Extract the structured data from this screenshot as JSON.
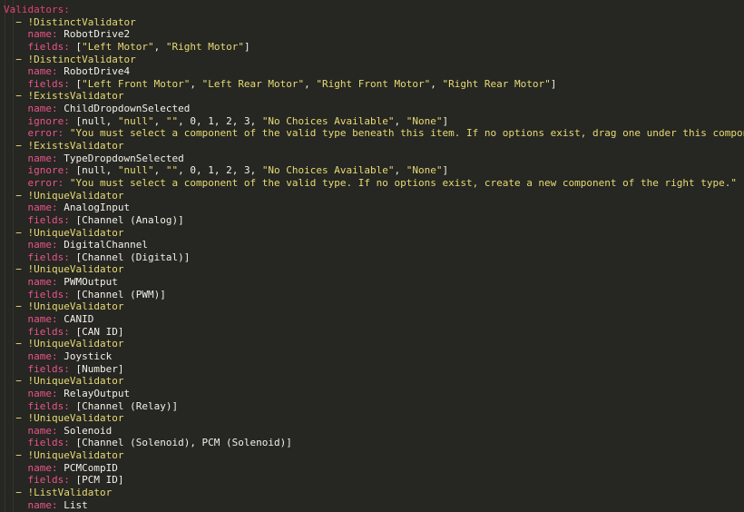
{
  "editor": {
    "background": "#262622",
    "language": "yaml",
    "colors": {
      "root_key": "#E0456F",
      "key": "#E8558A",
      "tag": "#E6DB74",
      "string": "#E6DB74",
      "plain": "#F2F0E8",
      "indent_guide": "#35342e"
    }
  },
  "document": {
    "root_key": "Validators:",
    "lines": [
      {
        "indent": 0,
        "type": "root",
        "text": "Validators:"
      },
      {
        "indent": 1,
        "type": "item",
        "tag": "!DistinctValidator"
      },
      {
        "indent": 2,
        "type": "pair",
        "key": "name:",
        "value": "RobotDrive2",
        "value_kind": "plain"
      },
      {
        "indent": 2,
        "type": "pair",
        "key": "fields:",
        "value": "[\"Left Motor\", \"Right Motor\"]",
        "value_kind": "seq"
      },
      {
        "indent": 1,
        "type": "item",
        "tag": "!DistinctValidator"
      },
      {
        "indent": 2,
        "type": "pair",
        "key": "name:",
        "value": "RobotDrive4",
        "value_kind": "plain"
      },
      {
        "indent": 2,
        "type": "pair",
        "key": "fields:",
        "value": "[\"Left Front Motor\", \"Left Rear Motor\", \"Right Front Motor\", \"Right Rear Motor\"]",
        "value_kind": "seq"
      },
      {
        "indent": 1,
        "type": "item",
        "tag": "!ExistsValidator"
      },
      {
        "indent": 2,
        "type": "pair",
        "key": "name:",
        "value": "ChildDropdownSelected",
        "value_kind": "plain"
      },
      {
        "indent": 2,
        "type": "pair",
        "key": "ignore:",
        "value": "[null, \"null\", \"\", 0, 1, 2, 3, \"No Choices Available\", \"None\"]",
        "value_kind": "seq"
      },
      {
        "indent": 2,
        "type": "pair",
        "key": "error:",
        "value": "\"You must select a component of the valid type beneath this item. If no options exist, drag one under this component.\"",
        "value_kind": "string"
      },
      {
        "indent": 1,
        "type": "item",
        "tag": "!ExistsValidator"
      },
      {
        "indent": 2,
        "type": "pair",
        "key": "name:",
        "value": "TypeDropdownSelected",
        "value_kind": "plain"
      },
      {
        "indent": 2,
        "type": "pair",
        "key": "ignore:",
        "value": "[null, \"null\", \"\", 0, 1, 2, 3, \"No Choices Available\", \"None\"]",
        "value_kind": "seq"
      },
      {
        "indent": 2,
        "type": "pair",
        "key": "error:",
        "value": "\"You must select a component of the valid type. If no options exist, create a new component of the right type.\"",
        "value_kind": "string"
      },
      {
        "indent": 1,
        "type": "item",
        "tag": "!UniqueValidator"
      },
      {
        "indent": 2,
        "type": "pair",
        "key": "name:",
        "value": "AnalogInput",
        "value_kind": "plain"
      },
      {
        "indent": 2,
        "type": "pair",
        "key": "fields:",
        "value": "[Channel (Analog)]",
        "value_kind": "plain"
      },
      {
        "indent": 1,
        "type": "item",
        "tag": "!UniqueValidator"
      },
      {
        "indent": 2,
        "type": "pair",
        "key": "name:",
        "value": "DigitalChannel",
        "value_kind": "plain"
      },
      {
        "indent": 2,
        "type": "pair",
        "key": "fields:",
        "value": "[Channel (Digital)]",
        "value_kind": "plain"
      },
      {
        "indent": 1,
        "type": "item",
        "tag": "!UniqueValidator"
      },
      {
        "indent": 2,
        "type": "pair",
        "key": "name:",
        "value": "PWMOutput",
        "value_kind": "plain"
      },
      {
        "indent": 2,
        "type": "pair",
        "key": "fields:",
        "value": "[Channel (PWM)]",
        "value_kind": "plain"
      },
      {
        "indent": 1,
        "type": "item",
        "tag": "!UniqueValidator"
      },
      {
        "indent": 2,
        "type": "pair",
        "key": "name:",
        "value": "CANID",
        "value_kind": "plain"
      },
      {
        "indent": 2,
        "type": "pair",
        "key": "fields:",
        "value": "[CAN ID]",
        "value_kind": "plain"
      },
      {
        "indent": 1,
        "type": "item",
        "tag": "!UniqueValidator"
      },
      {
        "indent": 2,
        "type": "pair",
        "key": "name:",
        "value": "Joystick",
        "value_kind": "plain"
      },
      {
        "indent": 2,
        "type": "pair",
        "key": "fields:",
        "value": "[Number]",
        "value_kind": "plain"
      },
      {
        "indent": 1,
        "type": "item",
        "tag": "!UniqueValidator"
      },
      {
        "indent": 2,
        "type": "pair",
        "key": "name:",
        "value": "RelayOutput",
        "value_kind": "plain"
      },
      {
        "indent": 2,
        "type": "pair",
        "key": "fields:",
        "value": "[Channel (Relay)]",
        "value_kind": "plain"
      },
      {
        "indent": 1,
        "type": "item",
        "tag": "!UniqueValidator"
      },
      {
        "indent": 2,
        "type": "pair",
        "key": "name:",
        "value": "Solenoid",
        "value_kind": "plain"
      },
      {
        "indent": 2,
        "type": "pair",
        "key": "fields:",
        "value": "[Channel (Solenoid), PCM (Solenoid)]",
        "value_kind": "plain"
      },
      {
        "indent": 1,
        "type": "item",
        "tag": "!UniqueValidator"
      },
      {
        "indent": 2,
        "type": "pair",
        "key": "name:",
        "value": "PCMCompID",
        "value_kind": "plain"
      },
      {
        "indent": 2,
        "type": "pair",
        "key": "fields:",
        "value": "[PCM ID]",
        "value_kind": "plain"
      },
      {
        "indent": 1,
        "type": "item",
        "tag": "!ListValidator"
      },
      {
        "indent": 2,
        "type": "pair",
        "key": "name:",
        "value": "List",
        "value_kind": "plain"
      }
    ]
  }
}
